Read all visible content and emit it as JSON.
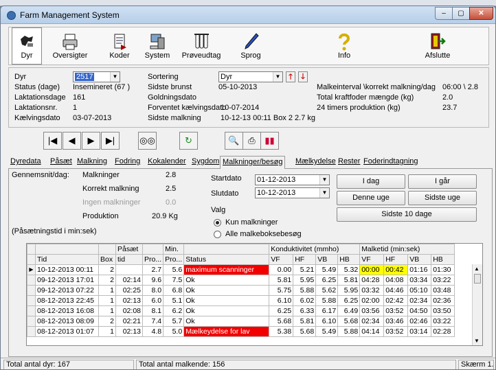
{
  "window": {
    "title": "Farm Management System",
    "min": "–",
    "max": "▢",
    "close": "✕"
  },
  "toolbar": [
    {
      "label": "Dyr",
      "icon": "cow-icon",
      "active": true
    },
    {
      "label": "Oversigter",
      "icon": "printer-icon"
    },
    {
      "label": "Koder",
      "icon": "document-icon"
    },
    {
      "label": "System",
      "icon": "computer-icon"
    },
    {
      "label": "Prøveudtag",
      "icon": "test-tube-icon"
    },
    {
      "label": "Sprog",
      "icon": "pen-icon"
    },
    {
      "label": "Info",
      "icon": "question-icon"
    },
    {
      "label": "Afslutte",
      "icon": "exit-door-icon"
    }
  ],
  "info": {
    "dyr_label": "Dyr",
    "dyr_value": "2517",
    "status_label": "Status (dage)",
    "status_value": "Insemineret (67 )",
    "lakdage_label": "Laktationsdage",
    "lakdage_value": "161",
    "laknr_label": "Laktationsnr.",
    "laknr_value": "1",
    "kalv_label": "Kælvingsdato",
    "kalv_value": "03-07-2013",
    "sort_label": "Sortering",
    "sort_value": "Dyr",
    "brunst_label": "Sidste brunst",
    "brunst_value": "05-10-2013",
    "golding_label": "Goldningsdato",
    "forv_label": "Forventet kælvingsdato",
    "forv_value": "10-07-2014",
    "sidste_label": "Sidste malkning",
    "sidste_value": "10-12-13 00:11  Box 2  2.7 kg",
    "malkint_label": "Malkeinterval \\korrekt malkning/dag",
    "malkint_value": "06:00 \\ 2.8",
    "kraft_label": "Total kraftfoder mængde (kg)",
    "kraft_value": "2.0",
    "prod24_label": "24 timers produktion (kg)",
    "prod24_value": "23.7"
  },
  "nav": [
    "|◀",
    "◀",
    "▶",
    "▶|"
  ],
  "tabs": [
    "Dyredata",
    "Påsæt",
    "Malkning",
    "Fodring",
    "Kokalender",
    "Sygdom",
    "Malkninger/besøg",
    "Mælkydelse",
    "Rester",
    "Foderindtagning"
  ],
  "panel": {
    "gennemsnit": "Gennemsnit/dag:",
    "malkninger_label": "Malkninger",
    "malkninger_value": "2.8",
    "korrekt_label": "Korrekt malkning",
    "korrekt_value": "2.5",
    "ingen_label": "Ingen malkninger",
    "ingen_value": "0.0",
    "prod_label": "Produktion",
    "prod_value": "20.9  Kg",
    "pasaet_note": "(Påsætningstid i min:sek)",
    "startdato_label": "Startdato",
    "startdato": "01-12-2013",
    "slutdato_label": "Slutdato",
    "slutdato": "10-12-2013",
    "valg_label": "Valg",
    "radio1": "Kun malkninger",
    "radio2": "Alle malkeboksebesøg",
    "btn_idag": "I dag",
    "btn_igar": "I går",
    "btn_denne": "Denne uge",
    "btn_sidste": "Sidste uge",
    "btn_10": "Sidste 10 dage"
  },
  "grid": {
    "group_headers": {
      "pasaet": "Påsæt",
      "min": "Min.",
      "kond": "Konduktivitet (mmho)",
      "malketid": "Malketid (min:sek)"
    },
    "columns": [
      "Tid",
      "Box",
      "tid",
      "Pro...",
      "Pro...",
      "Status",
      "VF",
      "HF",
      "VB",
      "HB",
      "VF",
      "HF",
      "VB",
      "HB"
    ],
    "rows": [
      [
        "10-12-2013 00:11",
        "2",
        "",
        "2.7",
        "5.6",
        "maximum scanninger",
        "0.00",
        "5.21",
        "5.49",
        "5.32",
        "00:00",
        "00:42",
        "01:16",
        "01:30"
      ],
      [
        "09-12-2013 17:01",
        "2",
        "02:14",
        "9.6",
        "7.5",
        "Ok",
        "5.81",
        "5.95",
        "6.25",
        "5.81",
        "04:28",
        "04:08",
        "03:34",
        "03:22"
      ],
      [
        "09-12-2013 07:22",
        "1",
        "02:25",
        "8.0",
        "6.8",
        "Ok",
        "5.75",
        "5.88",
        "5.62",
        "5.95",
        "03:32",
        "04:46",
        "05:10",
        "03:48"
      ],
      [
        "08-12-2013 22:45",
        "1",
        "02:13",
        "6.0",
        "5.1",
        "Ok",
        "6.10",
        "6.02",
        "5.88",
        "6.25",
        "02:00",
        "02:42",
        "02:34",
        "02:36"
      ],
      [
        "08-12-2013 16:08",
        "1",
        "02:08",
        "8.1",
        "6.2",
        "Ok",
        "6.25",
        "6.33",
        "6.17",
        "6.49",
        "03:56",
        "03:52",
        "04:50",
        "03:50"
      ],
      [
        "08-12-2013 08:09",
        "2",
        "02:21",
        "7.4",
        "5.7",
        "Ok",
        "5.68",
        "5.81",
        "6.10",
        "5.68",
        "02:34",
        "03:46",
        "02:46",
        "03:22"
      ],
      [
        "08-12-2013 01:07",
        "1",
        "02:13",
        "4.8",
        "5.0",
        "Mælkeydelse for lav",
        "5.38",
        "5.68",
        "5.49",
        "5.88",
        "04:14",
        "03:52",
        "03:14",
        "02:28"
      ]
    ],
    "red_status": [
      0,
      6
    ],
    "yellow_cells": [
      [
        0,
        10
      ],
      [
        0,
        11
      ]
    ]
  },
  "status": {
    "total_dyr": "Total antal dyr: 167",
    "total_malk": "Total antal malkende: 156",
    "skaerm": "Skærm 1.7"
  }
}
